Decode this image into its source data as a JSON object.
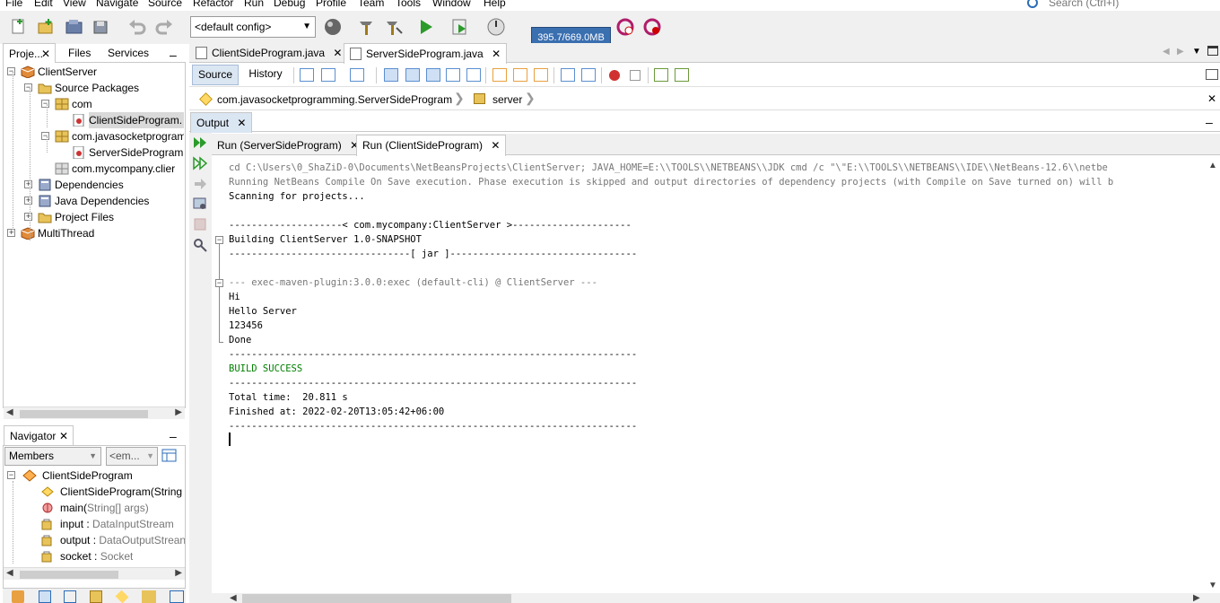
{
  "menu": [
    "File",
    "Edit",
    "View",
    "Navigate",
    "Source",
    "Refactor",
    "Run",
    "Debug",
    "Profile",
    "Team",
    "Tools",
    "Window",
    "Help"
  ],
  "search": {
    "placeholder": "Search (Ctrl+I)"
  },
  "toolbar": {
    "config": "<default config>",
    "memory": "395.7/669.0MB"
  },
  "projects_panel": {
    "tabs": [
      "Proje...",
      "Files",
      "Services"
    ],
    "tree": [
      {
        "label": "ClientServer",
        "level": 0,
        "icon": "project-icon",
        "exp": "-"
      },
      {
        "label": "Source Packages",
        "level": 1,
        "icon": "folder-icon",
        "exp": "-"
      },
      {
        "label": "com",
        "level": 2,
        "icon": "package-icon",
        "exp": "-"
      },
      {
        "label": "ClientSideProgram.",
        "level": 3,
        "icon": "java-file-icon",
        "exp": "",
        "selected": true
      },
      {
        "label": "com.javasocketprogram",
        "level": 2,
        "icon": "package-icon",
        "exp": "-"
      },
      {
        "label": "ServerSideProgram",
        "level": 3,
        "icon": "java-file-icon",
        "exp": ""
      },
      {
        "label": "com.mycompany.clier",
        "level": 2,
        "icon": "package-empty-icon",
        "exp": ""
      },
      {
        "label": "Dependencies",
        "level": 1,
        "icon": "library-icon",
        "exp": "+"
      },
      {
        "label": "Java Dependencies",
        "level": 1,
        "icon": "library-icon",
        "exp": "+"
      },
      {
        "label": "Project Files",
        "level": 1,
        "icon": "folder-icon",
        "exp": "+"
      },
      {
        "label": "MultiThread",
        "level": 0,
        "icon": "project-icon",
        "exp": "+"
      }
    ]
  },
  "navigator": {
    "title": "Navigator",
    "members": "Members",
    "filter": "<em...",
    "items": [
      {
        "name": "ClientSideProgram",
        "type": "",
        "icon": "class-icon",
        "level": 0
      },
      {
        "name": "ClientSideProgram(String a",
        "type": "",
        "icon": "constructor-icon",
        "level": 1
      },
      {
        "name": "main(",
        "type": "String[] args)",
        "icon": "method-icon",
        "level": 1
      },
      {
        "name": "input : ",
        "type": "DataInputStream",
        "icon": "field-icon",
        "level": 1
      },
      {
        "name": "output : ",
        "type": "DataOutputStrean",
        "icon": "field-icon",
        "level": 1
      },
      {
        "name": "socket : ",
        "type": "Socket",
        "icon": "field-icon",
        "level": 1
      }
    ]
  },
  "editor_tabs": [
    "ClientSideProgram.java",
    "ServerSideProgram.java"
  ],
  "editor_toolbar": {
    "source": "Source",
    "history": "History"
  },
  "breadcrumb": [
    "com.javasocketprogramming.ServerSideProgram",
    "server"
  ],
  "output": {
    "title": "Output",
    "run_tabs": [
      "Run (ServerSideProgram)",
      "Run (ClientSideProgram)"
    ],
    "lines": [
      {
        "t": "cd C:\\Users\\0_ShaZiD-0\\Documents\\NetBeansProjects\\ClientServer; JAVA_HOME=E:\\\\TOOLS\\\\NETBEANS\\\\JDK cmd /c \"\\\"E:\\\\TOOLS\\\\NETBEANS\\\\IDE\\\\NetBeans-12.6\\\\netbe",
        "c": "#777"
      },
      {
        "t": "Running NetBeans Compile On Save execution. Phase execution is skipped and output directories of dependency projects (with Compile on Save turned on) will b",
        "c": "#777"
      },
      {
        "t": "Scanning for projects...",
        "c": "#000"
      },
      {
        "t": "",
        "c": "#000"
      },
      {
        "t": "--------------------< com.mycompany:ClientServer >---------------------",
        "c": "#000"
      },
      {
        "t": "Building ClientServer 1.0-SNAPSHOT",
        "c": "#000"
      },
      {
        "t": "--------------------------------[ jar ]---------------------------------",
        "c": "#000"
      },
      {
        "t": "",
        "c": "#000"
      },
      {
        "t": "--- exec-maven-plugin:3.0.0:exec (default-cli) @ ClientServer ---",
        "c": "#777"
      },
      {
        "t": "Hi",
        "c": "#000"
      },
      {
        "t": "Hello Server",
        "c": "#000"
      },
      {
        "t": "123456",
        "c": "#000"
      },
      {
        "t": "Done",
        "c": "#000"
      },
      {
        "t": "------------------------------------------------------------------------",
        "c": "#000"
      },
      {
        "t": "BUILD SUCCESS",
        "c": "#008000"
      },
      {
        "t": "------------------------------------------------------------------------",
        "c": "#000"
      },
      {
        "t": "Total time:  20.811 s",
        "c": "#000"
      },
      {
        "t": "Finished at: 2022-02-20T13:05:42+06:00",
        "c": "#000"
      },
      {
        "t": "------------------------------------------------------------------------",
        "c": "#000"
      }
    ]
  }
}
